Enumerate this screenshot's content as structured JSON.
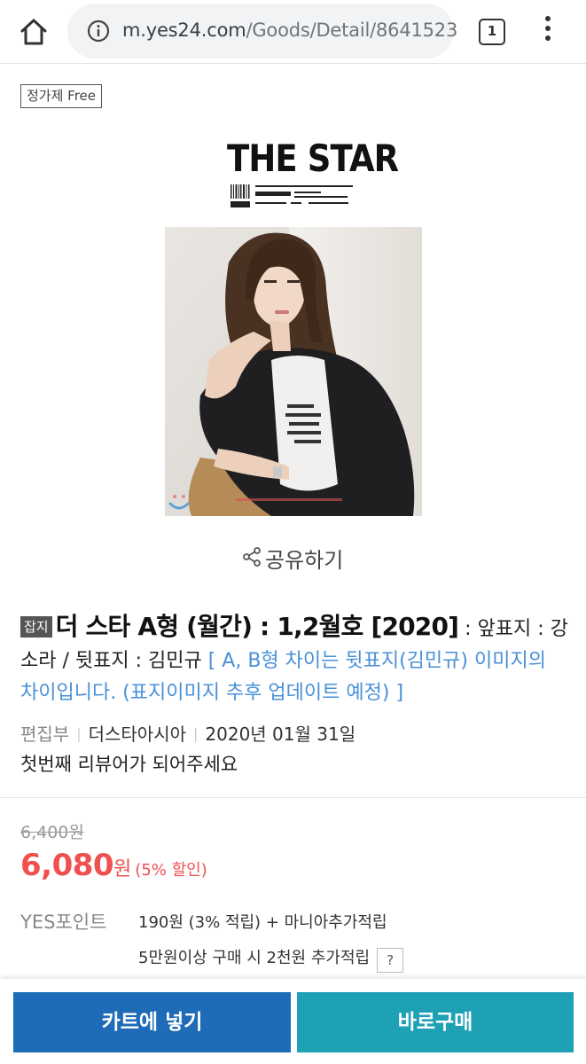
{
  "browser": {
    "url_host": "m.yes24.com",
    "url_path": "/Goods/Detail/8641523",
    "tab_count": "1"
  },
  "badge": {
    "label": "정가제 Free"
  },
  "cover": {
    "magazine_title": "THE STAR"
  },
  "share": {
    "label": "공유하기"
  },
  "product": {
    "category": "잡지",
    "title": "더 스타 A형 (월간) : 1,2월호 [2020]",
    "subtitle": " : 앞표지 : 강소라 / 뒷표지 : 김민규 ",
    "note": "[ A, B형 차이는 뒷표지(김민규) 이미지의 차이입니다. (표지이미지 추후 업데이트 예정) ]",
    "author": "편집부",
    "publisher": "더스타아시아",
    "date": "2020년 01월 31일",
    "review_prompt": "첫번째 리뷰어가 되어주세요"
  },
  "price": {
    "original": "6,400원",
    "sale_number": "6,080",
    "sale_unit": "원",
    "discount": "(5% 할인)"
  },
  "points": {
    "label": "YES포인트",
    "line1": "190원 (3% 적립) + 마니아추가적립",
    "line2": "5만원이상 구매 시 2천원 추가적립",
    "help": "?"
  },
  "actions": {
    "cart": "카트에 넣기",
    "buy": "바로구매"
  }
}
